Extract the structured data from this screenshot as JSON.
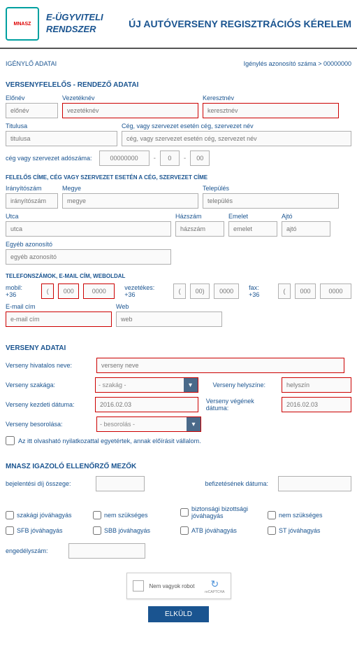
{
  "header": {
    "logo_text": "MNASZ",
    "brand_line1": "E-ÜGYVITELI",
    "brand_line2": "RENDSZER",
    "page_title": "ÚJ AUTÓVERSENY REGISZTRÁCIÓS KÉRELEM"
  },
  "breadcrumb": {
    "left": "IGÉNYLŐ ADATAI",
    "right": "Igénylés azonosító száma > 00000000"
  },
  "sections": {
    "organizer": "VERSENYFELELŐS - RENDEZŐ ADATAI",
    "address": "FELELŐS CÍME, CÉG VAGY SZERVEZET ESETÉN A CÉG, SZERVEZET CÍME",
    "contacts": "TELEFONSZÁMOK, E-MAIL CÍM, WEBOLDAL",
    "competition": "VERSENY ADATAI",
    "approval": "MNASZ IGAZOLÓ ELLENŐRZŐ MEZŐK"
  },
  "labels": {
    "elonev": "Előnév",
    "vezeteknev": "Vezetéknév",
    "keresztnev": "Keresztnév",
    "titulusa": "Titulusa",
    "ceg": "Cég, vagy szervezet esetén cég, szervezet név",
    "adoszam": "cég vagy szervezet adószáma:",
    "iranyitoszam": "Irányítószám",
    "megye": "Megye",
    "telepules": "Település",
    "utca": "Utca",
    "hazszam": "Házszám",
    "emelet": "Emelet",
    "ajto": "Ajtó",
    "egyeb": "Egyéb azonosító",
    "mobil": "mobil: +36",
    "vezetekes": "vezetékes: +36",
    "fax": "fax: +36",
    "email": "E-mail cím",
    "web": "Web",
    "verseny_nev": "Verseny hivatalos neve:",
    "szakag": "Verseny szakága:",
    "helyszin": "Verseny helyszíne:",
    "kezdet": "Verseny kezdeti dátuma:",
    "veg": "Verseny végének dátuma:",
    "besorolas": "Verseny besorolása:",
    "declaration_pre": "Az",
    "declaration_link": "itt olvasható nyilatkozattal",
    "declaration_post": "egyetértek, annak előírásit vállalom.",
    "dij": "bejelentési díj összege:",
    "befizetes": "befizetésének dátuma:",
    "chk_szakagi": "szakági jóváhagyás",
    "chk_nemszukseges1": "nem szükséges",
    "chk_biztonsagi": "biztonsági bizottsági jóváhagyás",
    "chk_nemszukseges2": "nem szükséges",
    "chk_sfb": "SFB jóváhagyás",
    "chk_sbb": "SBB jóváhagyás",
    "chk_atb": "ATB jóváhagyás",
    "chk_st": "ST jóváhagyás",
    "engedelyszam": "engedélyszám:",
    "captcha": "Nem vagyok robot",
    "submit": "ELKÜLD"
  },
  "placeholders": {
    "elonev": "előnév",
    "vezeteknev": "vezetéknév",
    "keresztnev": "keresztnév",
    "titulusa": "titulusa",
    "ceg": "cég, vagy szervezet esetén cég, szervezet név",
    "tax1": "00000000",
    "tax2": "0",
    "tax3": "00",
    "iranyitoszam": "irányítószám",
    "megye": "megye",
    "telepules": "település",
    "utca": "utca",
    "hazszam": "házszám",
    "emelet": "emelet",
    "ajto": "ajtó",
    "egyeb": "egyéb azonosító",
    "p1": "(",
    "p2": "00)",
    "p3": "000",
    "p4": "0000",
    "email": "e-mail cím",
    "web": "web",
    "verseny_nev": "verseny neve",
    "szakag": "- szakág -",
    "helyszin": "helyszín",
    "date": "2016.02.03",
    "besorolas": "- besorolás -"
  }
}
